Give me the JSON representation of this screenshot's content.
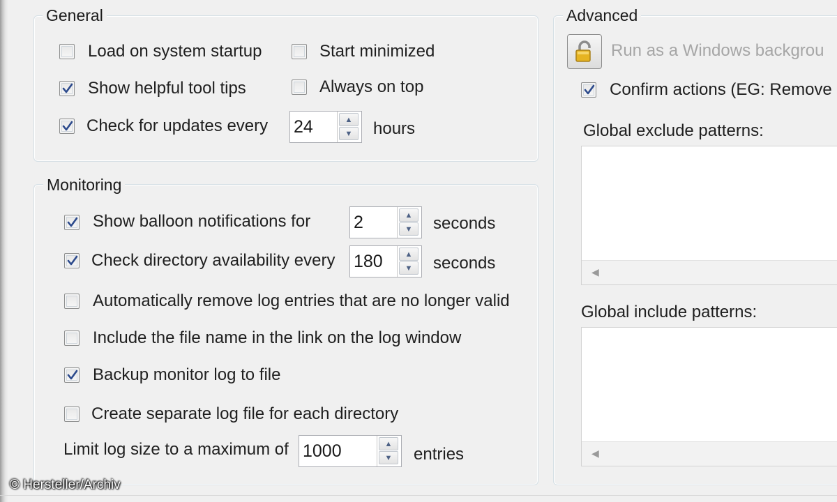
{
  "general": {
    "title": "General",
    "load_on_startup": {
      "label": "Load on system startup",
      "checked": false
    },
    "start_minimized": {
      "label": "Start minimized",
      "checked": false
    },
    "show_tooltips": {
      "label": "Show helpful tool tips",
      "checked": true
    },
    "always_on_top": {
      "label": "Always on top",
      "checked": false
    },
    "check_updates": {
      "label": "Check for updates every",
      "checked": true,
      "value": "24",
      "unit": "hours"
    }
  },
  "monitoring": {
    "title": "Monitoring",
    "balloon": {
      "label": "Show balloon notifications for",
      "checked": true,
      "value": "2",
      "unit": "seconds"
    },
    "dir_check": {
      "label": "Check directory availability every",
      "checked": true,
      "value": "180",
      "unit": "seconds"
    },
    "auto_remove": {
      "label": "Automatically remove log entries that are no longer valid",
      "checked": false
    },
    "include_filename": {
      "label": "Include the file name in the link on the log window",
      "checked": false
    },
    "backup_log": {
      "label": "Backup monitor log to file",
      "checked": true
    },
    "separate_log": {
      "label": "Create separate log file for each directory",
      "checked": false
    },
    "limit_log": {
      "label": "Limit log size to a maximum of",
      "value": "1000",
      "unit": "entries"
    }
  },
  "advanced": {
    "title": "Advanced",
    "run_service": {
      "label": "Run as a Windows backgrou"
    },
    "confirm_actions": {
      "label": "Confirm actions (EG: Remove",
      "checked": true
    },
    "exclude_label": "Global exclude patterns:",
    "include_label": "Global include patterns:"
  },
  "watermark": "© Hersteller/Archiv",
  "icons": {
    "checkmark": "checkmark-icon",
    "lock": "padlock-icon",
    "spin_up": "arrow-up-icon",
    "spin_down": "arrow-down-icon",
    "scroll_left": "arrow-left-icon"
  },
  "colors": {
    "checkmark": "#2c4a8c",
    "group_border": "#d5dfe5",
    "disabled_text": "#a6a6a6"
  }
}
